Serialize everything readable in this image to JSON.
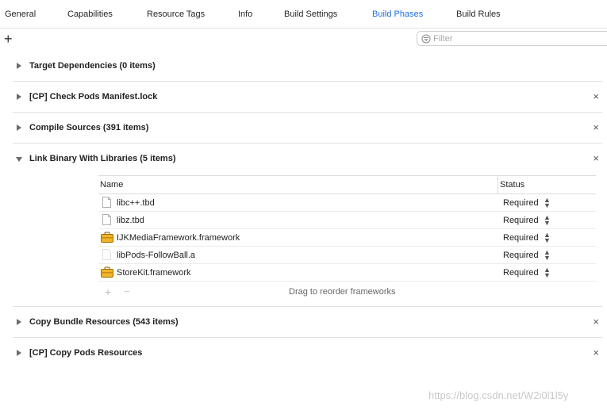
{
  "tabs": [
    {
      "label": "General"
    },
    {
      "label": "Capabilities"
    },
    {
      "label": "Resource Tags"
    },
    {
      "label": "Info"
    },
    {
      "label": "Build Settings"
    },
    {
      "label": "Build Phases",
      "active": true
    },
    {
      "label": "Build Rules"
    }
  ],
  "toolbar": {
    "add_symbol": "+",
    "filter_placeholder": "Filter"
  },
  "phases": [
    {
      "title": "Target Dependencies (0 items)",
      "expanded": false,
      "removable": false
    },
    {
      "title": "[CP] Check Pods Manifest.lock",
      "expanded": false,
      "removable": true
    },
    {
      "title": "Compile Sources (391 items)",
      "expanded": false,
      "removable": true
    },
    {
      "title": "Link Binary With Libraries (5 items)",
      "expanded": true,
      "removable": true
    },
    {
      "title": "Copy Bundle Resources (543 items)",
      "expanded": false,
      "removable": true
    },
    {
      "title": "[CP] Copy Pods Resources",
      "expanded": false,
      "removable": true
    }
  ],
  "remove_symbol": "×",
  "libraries": {
    "columns": {
      "name": "Name",
      "status": "Status"
    },
    "rows": [
      {
        "name": "libc++.tbd",
        "status": "Required",
        "icon": "file-icon"
      },
      {
        "name": "libz.tbd",
        "status": "Required",
        "icon": "file-icon"
      },
      {
        "name": "IJKMediaFramework.framework",
        "status": "Required",
        "icon": "framework-toolbox-icon"
      },
      {
        "name": "libPods-FollowBall.a",
        "status": "Required",
        "icon": "blank-file-icon"
      },
      {
        "name": "StoreKit.framework",
        "status": "Required",
        "icon": "framework-toolbox-icon"
      }
    ],
    "add_symbol": "+",
    "remove_symbol": "−",
    "hint": "Drag to reorder frameworks"
  },
  "watermark": "https://blog.csdn.net/W2i0l1l5y",
  "colors": {
    "accent": "#1f6fe0",
    "separator": "#e2e2e2"
  }
}
